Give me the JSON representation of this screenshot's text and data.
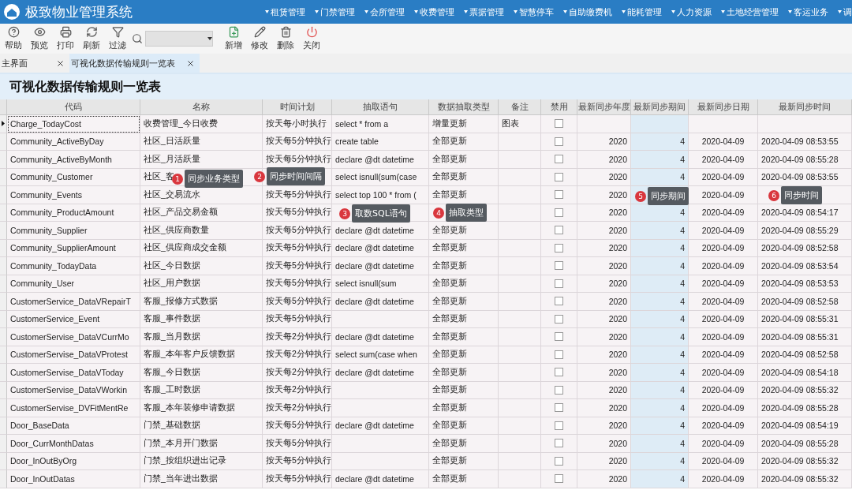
{
  "app": {
    "title": "极致物业管理系统"
  },
  "menu": [
    "租赁管理",
    "门禁管理",
    "会所管理",
    "收费管理",
    "票据管理",
    "智慧停车",
    "自助缴费机",
    "能耗管理",
    "人力资源",
    "土地经营管理",
    "客运业务",
    "调"
  ],
  "toolbar": [
    {
      "kind": "help",
      "label": "帮助"
    },
    {
      "kind": "preview",
      "label": "预览"
    },
    {
      "kind": "print",
      "label": "打印"
    },
    {
      "kind": "refresh",
      "label": "刷新"
    },
    {
      "kind": "filter",
      "label": "过滤"
    },
    {
      "kind": "search"
    },
    {
      "kind": "add",
      "label": "新增"
    },
    {
      "kind": "edit",
      "label": "修改"
    },
    {
      "kind": "delete",
      "label": "删除"
    },
    {
      "kind": "close",
      "label": "关闭"
    }
  ],
  "tabs": [
    {
      "label": "主界面",
      "selected": false
    },
    {
      "label": "可视化数据传输规则一览表",
      "selected": true
    }
  ],
  "page_title": "可视化数据传输规则一览表",
  "table": {
    "columns": [
      "代码",
      "名称",
      "时间计划",
      "抽取语句",
      "数据抽取类型",
      "备注",
      "禁用",
      "最新同步年度",
      "最新同步期间",
      "最新同步日期",
      "最新同步时间"
    ],
    "rows": [
      {
        "selected": true,
        "code": "Charge_TodayCost",
        "name": "收费管理_今日收费",
        "schedule": "按天每小时执行",
        "sql": "select * from a",
        "type": "增量更新",
        "note": "图表",
        "disabled": false
      },
      {
        "selected": false,
        "code": "Community_ActiveByDay",
        "name": "社区_日活跃量",
        "schedule": "按天每5分钟执行",
        "sql": "create table",
        "type": "全部更新",
        "disabled": false,
        "year": "2020",
        "period": "4",
        "date": "2020-04-09",
        "time": "2020-04-09 08:53:55"
      },
      {
        "selected": false,
        "code": "Community_ActiveByMonth",
        "name": "社区_月活跃量",
        "schedule": "按天每5分钟执行",
        "sql": "declare @dt datetime",
        "type": "全部更新",
        "disabled": false,
        "year": "2020",
        "period": "4",
        "date": "2020-04-09",
        "time": "2020-04-09 08:55:28"
      },
      {
        "selected": false,
        "code": "Community_Customer",
        "name": "社区_客",
        "sql": "select isnull(sum(case",
        "type": "全部更新",
        "disabled": false,
        "year": "2020",
        "period": "4",
        "date": "2020-04-09",
        "time": "2020-04-09 08:53:55"
      },
      {
        "selected": false,
        "code": "Community_Events",
        "name": "社区_交易流水",
        "schedule": "按天每5分钟执行",
        "sql": "select top 100 * from (",
        "type": "全部更新",
        "disabled": false,
        "year": "2020",
        "date": "2020-04-09"
      },
      {
        "selected": false,
        "code": "Community_ProductAmount",
        "name": "社区_产品交易金额",
        "schedule": "按天每5分钟执行",
        "disabled": false,
        "year": "2020",
        "period": "4",
        "date": "2020-04-09",
        "time": "2020-04-09 08:54:17"
      },
      {
        "selected": false,
        "code": "Community_Supplier",
        "name": "社区_供应商数量",
        "schedule": "按天每5分钟执行",
        "sql": "declare @dt datetime",
        "type": "全部更新",
        "disabled": false,
        "year": "2020",
        "period": "4",
        "date": "2020-04-09",
        "time": "2020-04-09 08:55:29"
      },
      {
        "selected": false,
        "code": "Community_SupplierAmount",
        "name": "社区_供应商成交金额",
        "schedule": "按天每5分钟执行",
        "sql": "declare @dt datetime",
        "type": "全部更新",
        "disabled": false,
        "year": "2020",
        "period": "4",
        "date": "2020-04-09",
        "time": "2020-04-09 08:52:58"
      },
      {
        "selected": false,
        "code": "Community_TodayData",
        "name": "社区_今日数据",
        "schedule": "按天每5分钟执行",
        "sql": "declare @dt datetime",
        "type": "全部更新",
        "disabled": false,
        "year": "2020",
        "period": "4",
        "date": "2020-04-09",
        "time": "2020-04-09 08:53:54"
      },
      {
        "selected": false,
        "code": "Community_User",
        "name": "社区_用户数据",
        "schedule": "按天每5分钟执行",
        "sql": "select isnull(sum",
        "type": "全部更新",
        "disabled": false,
        "year": "2020",
        "period": "4",
        "date": "2020-04-09",
        "time": "2020-04-09 08:53:53"
      },
      {
        "selected": false,
        "code": "CustomerService_DataVRepairT",
        "name": "客服_报修方式数据",
        "schedule": "按天每5分钟执行",
        "sql": "declare @dt datetime",
        "type": "全部更新",
        "disabled": false,
        "year": "2020",
        "period": "4",
        "date": "2020-04-09",
        "time": "2020-04-09 08:52:58"
      },
      {
        "selected": false,
        "code": "CustomerService_Event",
        "name": "客服_事件数据",
        "schedule": "按天每5分钟执行",
        "type": "全部更新",
        "disabled": false,
        "year": "2020",
        "period": "4",
        "date": "2020-04-09",
        "time": "2020-04-09 08:55:31"
      },
      {
        "selected": false,
        "code": "CustomerServise_DataVCurrMo",
        "name": "客服_当月数据",
        "schedule": "按天每2分钟执行",
        "sql": "declare @dt datetime",
        "type": "全部更新",
        "disabled": false,
        "year": "2020",
        "period": "4",
        "date": "2020-04-09",
        "time": "2020-04-09 08:55:31"
      },
      {
        "selected": false,
        "code": "CustomerServise_DataVProtest",
        "name": "客服_本年客户反馈数据",
        "schedule": "按天每2分钟执行",
        "sql": "select sum(case when",
        "type": "全部更新",
        "disabled": false,
        "year": "2020",
        "period": "4",
        "date": "2020-04-09",
        "time": "2020-04-09 08:52:58"
      },
      {
        "selected": false,
        "code": "CustomerServise_DataVToday",
        "name": "客服_今日数据",
        "schedule": "按天每2分钟执行",
        "sql": "declare @dt datetime",
        "type": "全部更新",
        "disabled": false,
        "year": "2020",
        "period": "4",
        "date": "2020-04-09",
        "time": "2020-04-09 08:54:18"
      },
      {
        "selected": false,
        "code": "CustomerServise_DataVWorkin",
        "name": "客服_工时数据",
        "schedule": "按天每2分钟执行",
        "type": "全部更新",
        "disabled": false,
        "year": "2020",
        "period": "4",
        "date": "2020-04-09",
        "time": "2020-04-09 08:55:32"
      },
      {
        "selected": false,
        "code": "CustomerServise_DVFitMentRe",
        "name": "客服_本年装修申请数据",
        "schedule": "按天每2分钟执行",
        "type": "全部更新",
        "disabled": false,
        "year": "2020",
        "period": "4",
        "date": "2020-04-09",
        "time": "2020-04-09 08:55:28"
      },
      {
        "selected": false,
        "code": "Door_BaseData",
        "name": "门禁_基础数据",
        "schedule": "按天每5分钟执行",
        "sql": "declare @dt datetime",
        "type": "全部更新",
        "disabled": false,
        "year": "2020",
        "period": "4",
        "date": "2020-04-09",
        "time": "2020-04-09 08:54:19"
      },
      {
        "selected": false,
        "code": "Door_CurrMonthDatas",
        "name": "门禁_本月开门数据",
        "schedule": "按天每5分钟执行",
        "type": "全部更新",
        "disabled": false,
        "year": "2020",
        "period": "4",
        "date": "2020-04-09",
        "time": "2020-04-09 08:55:28"
      },
      {
        "selected": false,
        "code": "Door_InOutByOrg",
        "name": "门禁_按组织进出记录",
        "schedule": "按天每5分钟执行",
        "type": "全部更新",
        "disabled": false,
        "year": "2020",
        "period": "4",
        "date": "2020-04-09",
        "time": "2020-04-09 08:55:32"
      },
      {
        "selected": false,
        "code": "Door_InOutDatas",
        "name": "门禁_当年进出数据",
        "schedule": "按天每5分钟执行",
        "sql": "declare @dt datetime",
        "type": "全部更新",
        "disabled": false,
        "year": "2020",
        "period": "4",
        "date": "2020-04-09",
        "time": "2020-04-09 08:55:32"
      }
    ]
  },
  "callouts": [
    {
      "number": "1",
      "label": "同步业务类型"
    },
    {
      "number": "2",
      "label": "同步时间间隔"
    },
    {
      "number": "3",
      "label": "取数SQL语句"
    },
    {
      "number": "4",
      "label": "抽取类型"
    },
    {
      "number": "5",
      "label": "同步期间"
    },
    {
      "number": "6",
      "label": "同步时间"
    }
  ]
}
